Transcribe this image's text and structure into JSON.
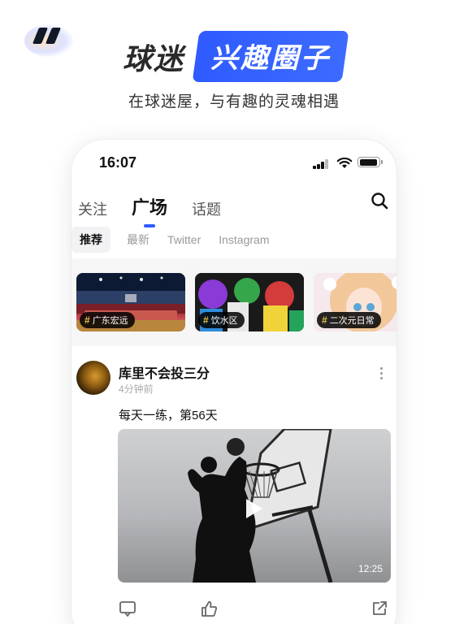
{
  "promo": {
    "headline_left": "球迷",
    "headline_highlight": "兴趣圈子",
    "subtitle": "在球迷屋，与有趣的灵魂相遇",
    "accent_color": "#2f5bff"
  },
  "statusbar": {
    "time": "16:07",
    "icons": [
      "signal-icon",
      "wifi-icon",
      "battery-icon"
    ]
  },
  "main_tabs": [
    {
      "label": "关注",
      "active": false
    },
    {
      "label": "广场",
      "active": true
    },
    {
      "label": "话题",
      "active": false
    }
  ],
  "sub_tabs": [
    {
      "label": "推荐",
      "active": true
    },
    {
      "label": "最新",
      "active": false
    },
    {
      "label": "Twitter",
      "active": false
    },
    {
      "label": "Instagram",
      "active": false
    }
  ],
  "topics": [
    {
      "label": "广东宏远",
      "icon": "hash-icon"
    },
    {
      "label": "饮水区",
      "icon": "hash-icon"
    },
    {
      "label": "二次元日常",
      "icon": "hash-icon"
    }
  ],
  "post": {
    "author": "库里不会投三分",
    "time_ago": "4分钟前",
    "text": "每天一练，第56天",
    "video_duration": "12:25",
    "actions": [
      "comment-icon",
      "like-icon",
      "share-icon"
    ]
  }
}
